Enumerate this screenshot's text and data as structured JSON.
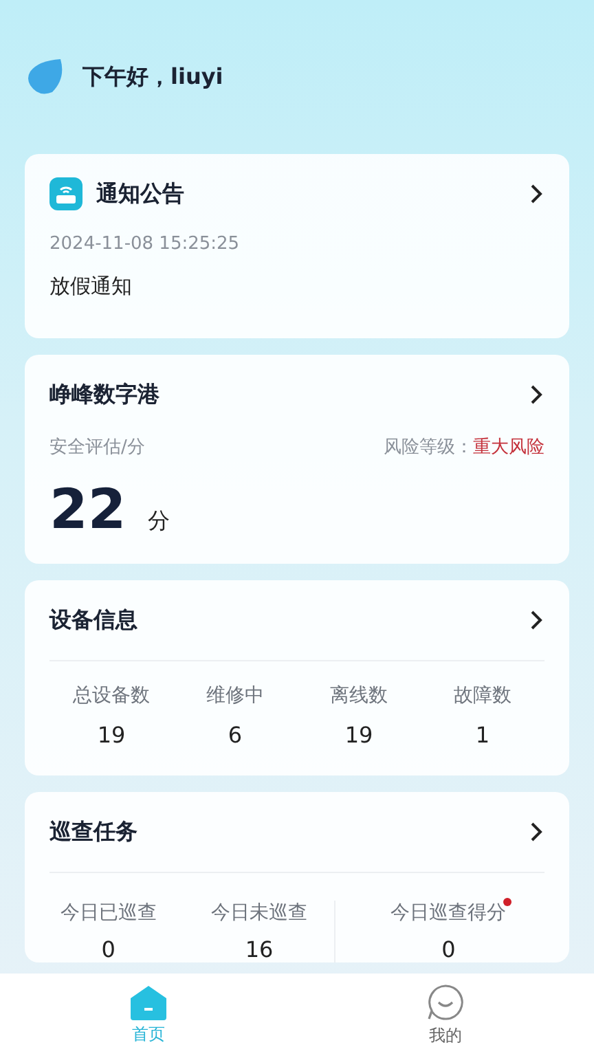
{
  "greeting": "下午好，liuyi",
  "notice": {
    "title": "通知公告",
    "time": "2024-11-08 15:25:25",
    "content": "放假通知"
  },
  "port": {
    "title": "峥峰数字港",
    "score_label": "安全评估/分",
    "risk_label": "风险等级：",
    "risk_value": "重大风险",
    "score": "22",
    "unit": "分"
  },
  "devices": {
    "title": "设备信息",
    "stats": [
      {
        "label": "总设备数",
        "value": "19"
      },
      {
        "label": "维修中",
        "value": "6"
      },
      {
        "label": "离线数",
        "value": "19"
      },
      {
        "label": "故障数",
        "value": "1"
      }
    ]
  },
  "patrol": {
    "title": "巡查任务",
    "stats": [
      {
        "label": "今日已巡查",
        "value": "0",
        "alert": false
      },
      {
        "label": "今日未巡查",
        "value": "16",
        "alert": false
      },
      {
        "label": "今日巡查得分",
        "value": "0",
        "alert": true
      }
    ]
  },
  "tabs": [
    {
      "label": "首页",
      "kind": "home",
      "selected": true
    },
    {
      "label": "我的",
      "kind": "profile",
      "selected": false
    }
  ]
}
